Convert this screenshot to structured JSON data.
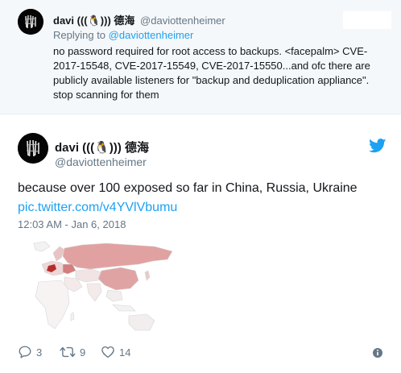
{
  "reply_tweet": {
    "author_name": "davi (((🐧))) 德海",
    "author_handle": "@daviottenheimer",
    "replying_to_prefix": "Replying to",
    "replying_to_handle": "@daviottenheimer",
    "text": "no password required for root access to backups. <facepalm> CVE-2017-15548, CVE-2017-15549, CVE-2017-15550...and ofc there are publicly available listeners for \"backup and deduplication appliance\". stop scanning for them"
  },
  "main_tweet": {
    "author_name": "davi (((🐧))) 德海",
    "author_handle": "@daviottenheimer",
    "text": "because over 100 exposed so far in China, Russia, Ukraine",
    "link": "pic.twitter.com/v4YVlVbumu",
    "timestamp": "12:03 AM - Jan 6, 2018",
    "replies_count": "3",
    "retweets_count": "9",
    "likes_count": "14"
  },
  "icons": {
    "brand": "twitter-bird-icon",
    "reply": "reply-icon",
    "retweet": "retweet-icon",
    "like": "heart-icon",
    "more": "more-icon"
  },
  "colors": {
    "accent": "#1da1f2",
    "muted": "#657786",
    "reply_bg": "#f5f8fa",
    "map_highlight": "#e0a3a3",
    "map_hot": "#b52d2d"
  }
}
